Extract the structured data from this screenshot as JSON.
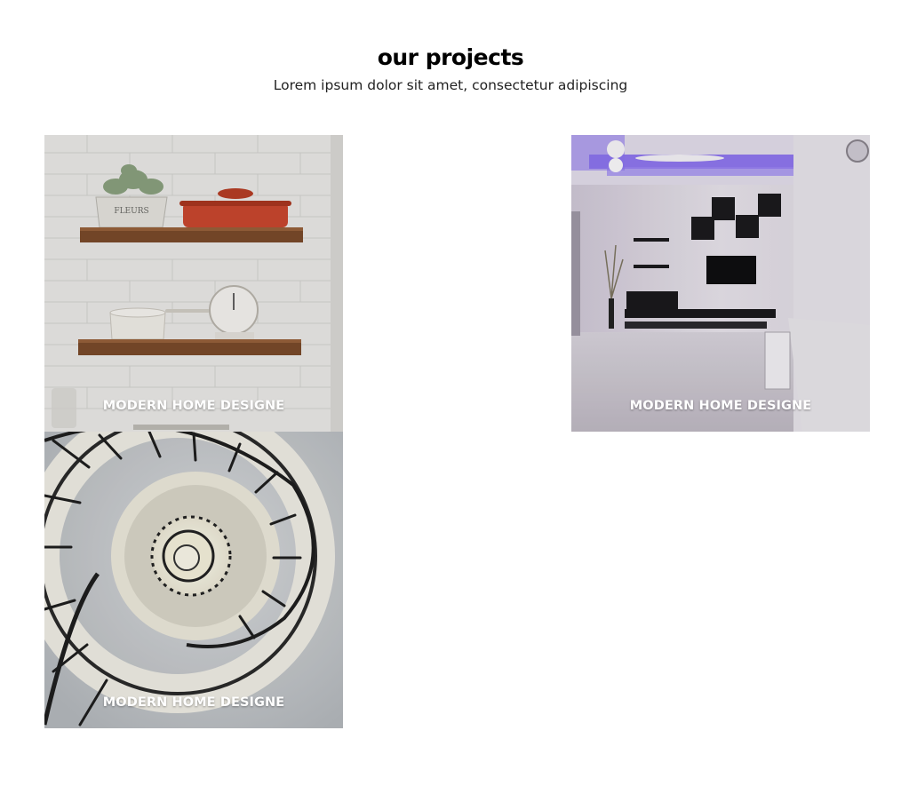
{
  "section": {
    "title": "our projects",
    "subtitle": "Lorem ipsum dolor sit amet, consectetur adipiscing"
  },
  "projects": [
    {
      "caption": "MODERN HOME DESIGNE",
      "image": "kitchen-shelves-photo"
    },
    {
      "caption": "MODERN HOME DESIGNE",
      "image": "living-room-tv-wall-photo"
    },
    {
      "caption": "MODERN HOME DESIGNE",
      "image": "spiral-staircase-photo"
    }
  ],
  "colors": {
    "background": "#ffffff",
    "title": "#000000",
    "caption": "#ffffff",
    "ceiling_glow": "#7a5cf0"
  }
}
